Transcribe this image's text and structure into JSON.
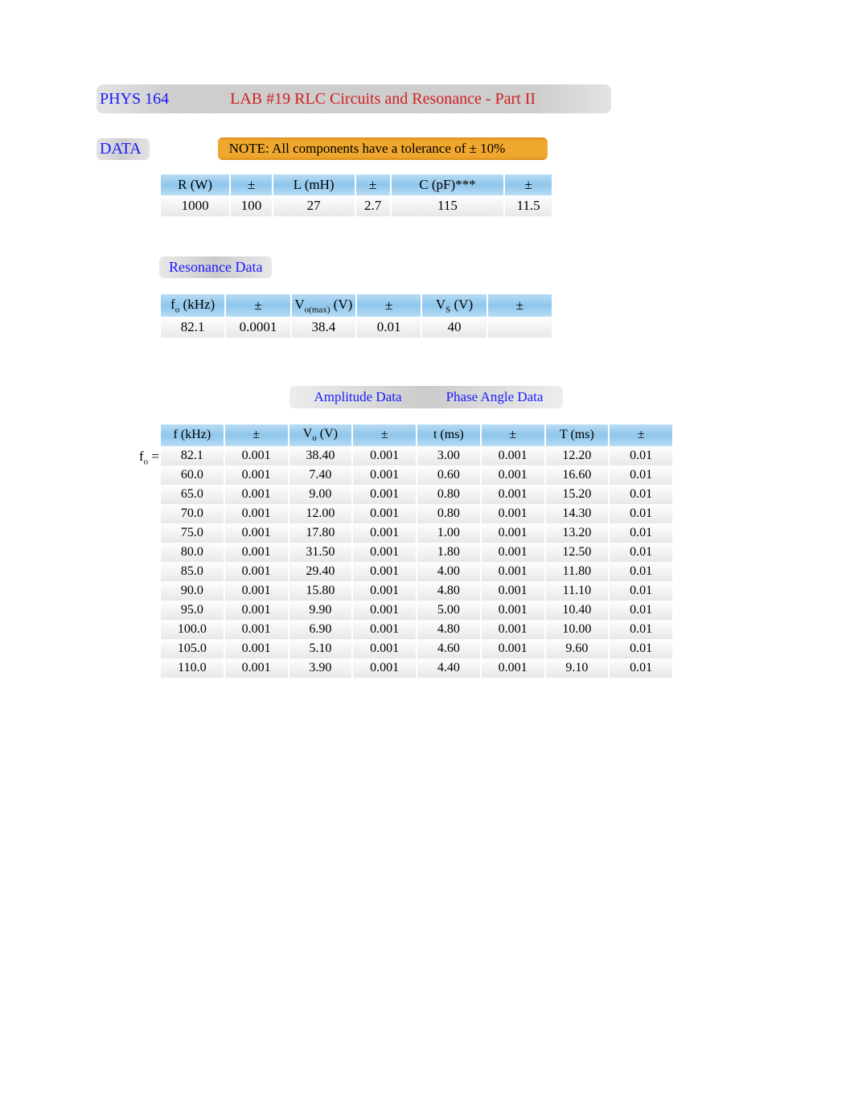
{
  "header": {
    "course": "PHYS 164",
    "lab": "LAB #19    RLC Circuits and Resonance - Part II"
  },
  "data_label": "DATA",
  "note": "NOTE: All components have a tolerance of ± 10%",
  "components": {
    "headers": {
      "R": "R (W)",
      "Rpm": "±",
      "L": "L (mH)",
      "Lpm": "±",
      "C": "C (pF)***",
      "Cpm": "±"
    },
    "row": {
      "R": "1000",
      "Rpm": "100",
      "L": "27",
      "Lpm": "2.7",
      "C": "115",
      "Cpm": "11.5"
    }
  },
  "resonance": {
    "label": "Resonance Data",
    "headers": {
      "fo_pre": "f",
      "fo_sub": "o",
      "fo_post": " (kHz)",
      "fopm": "±",
      "vom_pre": "V",
      "vom_sub": "o(max)",
      "vom_post": " (V)",
      "vompm": "±",
      "vs_pre": "V",
      "vs_sub": "S",
      "vs_post": " (V)",
      "vspm": "±"
    },
    "row": {
      "fo": "82.1",
      "fopm": "0.0001",
      "vom": "38.4",
      "vompm": "0.01",
      "vs": "40",
      "vspm": ""
    }
  },
  "amp_phase": {
    "amp_label": "Amplitude Data",
    "phase_label": "Phase Angle Data"
  },
  "fo_eq_pre": "f",
  "fo_eq_sub": "o",
  "fo_eq_post": "  =",
  "main": {
    "headers": {
      "f": "f (kHz)",
      "fpm": "±",
      "vo_pre": "V",
      "vo_sub": "o",
      "vo_post": " (V)",
      "vopm": "±",
      "t": "t   (ms)",
      "tpm": "±",
      "T": "T (ms)",
      "Tpm": "±"
    },
    "rows": [
      {
        "f": "82.1",
        "fpm": "0.001",
        "vo": "38.40",
        "vopm": "0.001",
        "t": "3.00",
        "tpm": "0.001",
        "T": "12.20",
        "Tpm": "0.01"
      },
      {
        "f": "60.0",
        "fpm": "0.001",
        "vo": "7.40",
        "vopm": "0.001",
        "t": "0.60",
        "tpm": "0.001",
        "T": "16.60",
        "Tpm": "0.01"
      },
      {
        "f": "65.0",
        "fpm": "0.001",
        "vo": "9.00",
        "vopm": "0.001",
        "t": "0.80",
        "tpm": "0.001",
        "T": "15.20",
        "Tpm": "0.01"
      },
      {
        "f": "70.0",
        "fpm": "0.001",
        "vo": "12.00",
        "vopm": "0.001",
        "t": "0.80",
        "tpm": "0.001",
        "T": "14.30",
        "Tpm": "0.01"
      },
      {
        "f": "75.0",
        "fpm": "0.001",
        "vo": "17.80",
        "vopm": "0.001",
        "t": "1.00",
        "tpm": "0.001",
        "T": "13.20",
        "Tpm": "0.01"
      },
      {
        "f": "80.0",
        "fpm": "0.001",
        "vo": "31.50",
        "vopm": "0.001",
        "t": "1.80",
        "tpm": "0.001",
        "T": "12.50",
        "Tpm": "0.01"
      },
      {
        "f": "85.0",
        "fpm": "0.001",
        "vo": "29.40",
        "vopm": "0.001",
        "t": "4.00",
        "tpm": "0.001",
        "T": "11.80",
        "Tpm": "0.01"
      },
      {
        "f": "90.0",
        "fpm": "0.001",
        "vo": "15.80",
        "vopm": "0.001",
        "t": "4.80",
        "tpm": "0.001",
        "T": "11.10",
        "Tpm": "0.01"
      },
      {
        "f": "95.0",
        "fpm": "0.001",
        "vo": "9.90",
        "vopm": "0.001",
        "t": "5.00",
        "tpm": "0.001",
        "T": "10.40",
        "Tpm": "0.01"
      },
      {
        "f": "100.0",
        "fpm": "0.001",
        "vo": "6.90",
        "vopm": "0.001",
        "t": "4.80",
        "tpm": "0.001",
        "T": "10.00",
        "Tpm": "0.01"
      },
      {
        "f": "105.0",
        "fpm": "0.001",
        "vo": "5.10",
        "vopm": "0.001",
        "t": "4.60",
        "tpm": "0.001",
        "T": "9.60",
        "Tpm": "0.01"
      },
      {
        "f": "110.0",
        "fpm": "0.001",
        "vo": "3.90",
        "vopm": "0.001",
        "t": "4.40",
        "tpm": "0.001",
        "T": "9.10",
        "Tpm": "0.01"
      }
    ]
  }
}
